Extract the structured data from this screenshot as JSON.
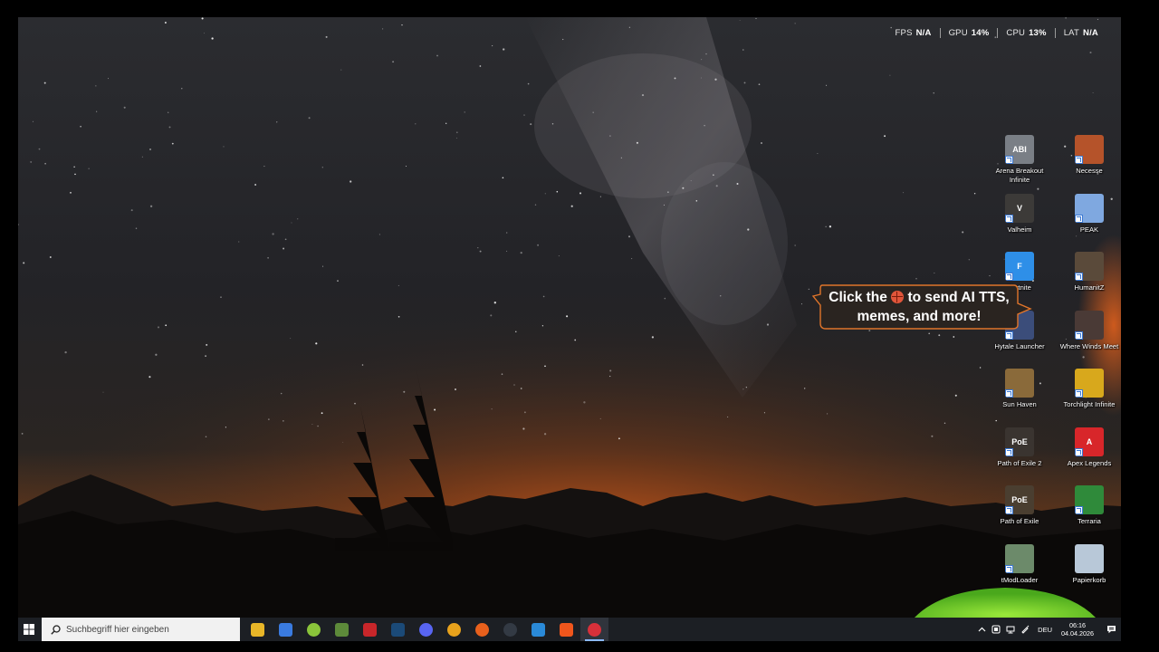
{
  "overlay": {
    "stats": [
      {
        "label": "FPS",
        "value": "N/A"
      },
      {
        "label": "GPU",
        "value": "14%"
      },
      {
        "label": "CPU",
        "value": "13%"
      },
      {
        "label": "LAT",
        "value": "N/A"
      }
    ]
  },
  "desktop_icons": [
    {
      "label": "Arena Breakout Infinite",
      "badge": "ABI",
      "color": "#7a7f86"
    },
    {
      "label": "Necesse",
      "badge": "",
      "color": "#b5532a"
    },
    {
      "label": "Valheim",
      "badge": "V",
      "color": "#3c3a38"
    },
    {
      "label": "PEAK",
      "badge": "",
      "color": "#7fa8e0"
    },
    {
      "label": "Fortnite",
      "badge": "F",
      "color": "#2e8fe8"
    },
    {
      "label": "HumanitZ",
      "badge": "",
      "color": "#5a4a3a"
    },
    {
      "label": "Hytale Launcher",
      "badge": "",
      "color": "#3b4d7a"
    },
    {
      "label": "Where Winds Meet",
      "badge": "",
      "color": "#4a3a36"
    },
    {
      "label": "Sun Haven",
      "badge": "",
      "color": "#8a6a3a"
    },
    {
      "label": "Torchlight Infinite",
      "badge": "",
      "color": "#d8a81c"
    },
    {
      "label": "Path of Exile 2",
      "badge": "PoE",
      "color": "#3a3430"
    },
    {
      "label": "Apex Legends",
      "badge": "A",
      "color": "#d8262a"
    },
    {
      "label": "Path of Exile",
      "badge": "PoE",
      "color": "#4a3e30"
    },
    {
      "label": "Terraria",
      "badge": "",
      "color": "#2f8a3a"
    },
    {
      "label": "tModLoader",
      "badge": "",
      "color": "#6c8a6a"
    },
    {
      "label": "Papierkorb",
      "badge": "",
      "color": "#b8c8d8"
    }
  ],
  "tooltip": {
    "before": "Click the ",
    "after": " to send AI TTS, memes, and more!",
    "icon": "basketball-icon"
  },
  "taskbar": {
    "search_placeholder": "Suchbegriff hier eingeben",
    "apps": [
      {
        "name": "file-explorer-icon",
        "color": "#e8b628"
      },
      {
        "name": "microsoft-store-icon",
        "color": "#3a7be0"
      },
      {
        "name": "android-app-icon",
        "color": "#8ac43a"
      },
      {
        "name": "minecraft-icon",
        "color": "#5d8a3a"
      },
      {
        "name": "game-app-icon",
        "color": "#c8262a"
      },
      {
        "name": "steam-icon",
        "color": "#1b4a78"
      },
      {
        "name": "discord-icon",
        "color": "#5865f2"
      },
      {
        "name": "chrome-icon",
        "color": "#e8a21c"
      },
      {
        "name": "firefox-icon",
        "color": "#e8601c"
      },
      {
        "name": "speedometer-icon",
        "color": "#333a44"
      },
      {
        "name": "blue-app-icon",
        "color": "#2a8ad8"
      },
      {
        "name": "brave-icon",
        "color": "#f0561c"
      },
      {
        "name": "overlay-app-icon",
        "color": "#d8303a"
      }
    ],
    "language": "DEU",
    "time": "06:16",
    "date": "04.04.2026"
  }
}
